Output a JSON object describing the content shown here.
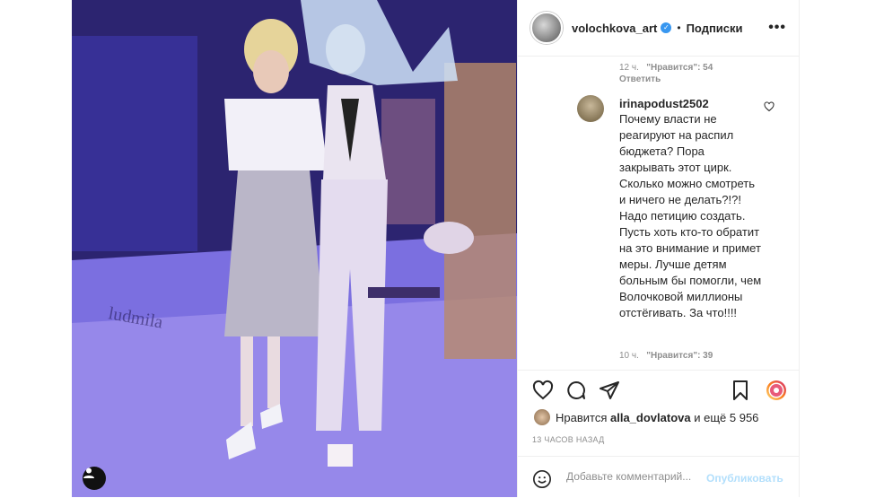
{
  "post": {
    "username": "volochkova_art",
    "separator": "•",
    "follow_label": "Подписки",
    "more_label": "•••"
  },
  "comments": {
    "prev_time": "12 ч.",
    "prev_likes": "\"Нравится\": 54",
    "prev_reply": "Ответить",
    "comment_user": "irinapodust2502",
    "comment_text": "Почему власти не реагируют на распил бюджета? Пора закрывать этот цирк. Сколько можно смотреть и ничего не делать?!?! Надо петицию создать. Пусть хоть кто-то обратит на это внимание и примет меры. Лучше детям больным бы помогли, чем Волочковой миллионы отстёгивать. За что!!!!",
    "comment_time": "10 ч.",
    "comment_likes": "\"Нравится\": 39"
  },
  "likes": {
    "prefix": "Нравится",
    "user": "alla_dovlatova",
    "suffix": "и ещё 5 956"
  },
  "timestamp": "13 ЧАСОВ НАЗАД",
  "add_comment": {
    "placeholder": "Добавьте комментарий...",
    "publish_label": "Опубликовать"
  },
  "colors": {
    "accent": "#3897f0",
    "publish_disabled": "#b2dffc",
    "muted": "#8e8e8e"
  }
}
